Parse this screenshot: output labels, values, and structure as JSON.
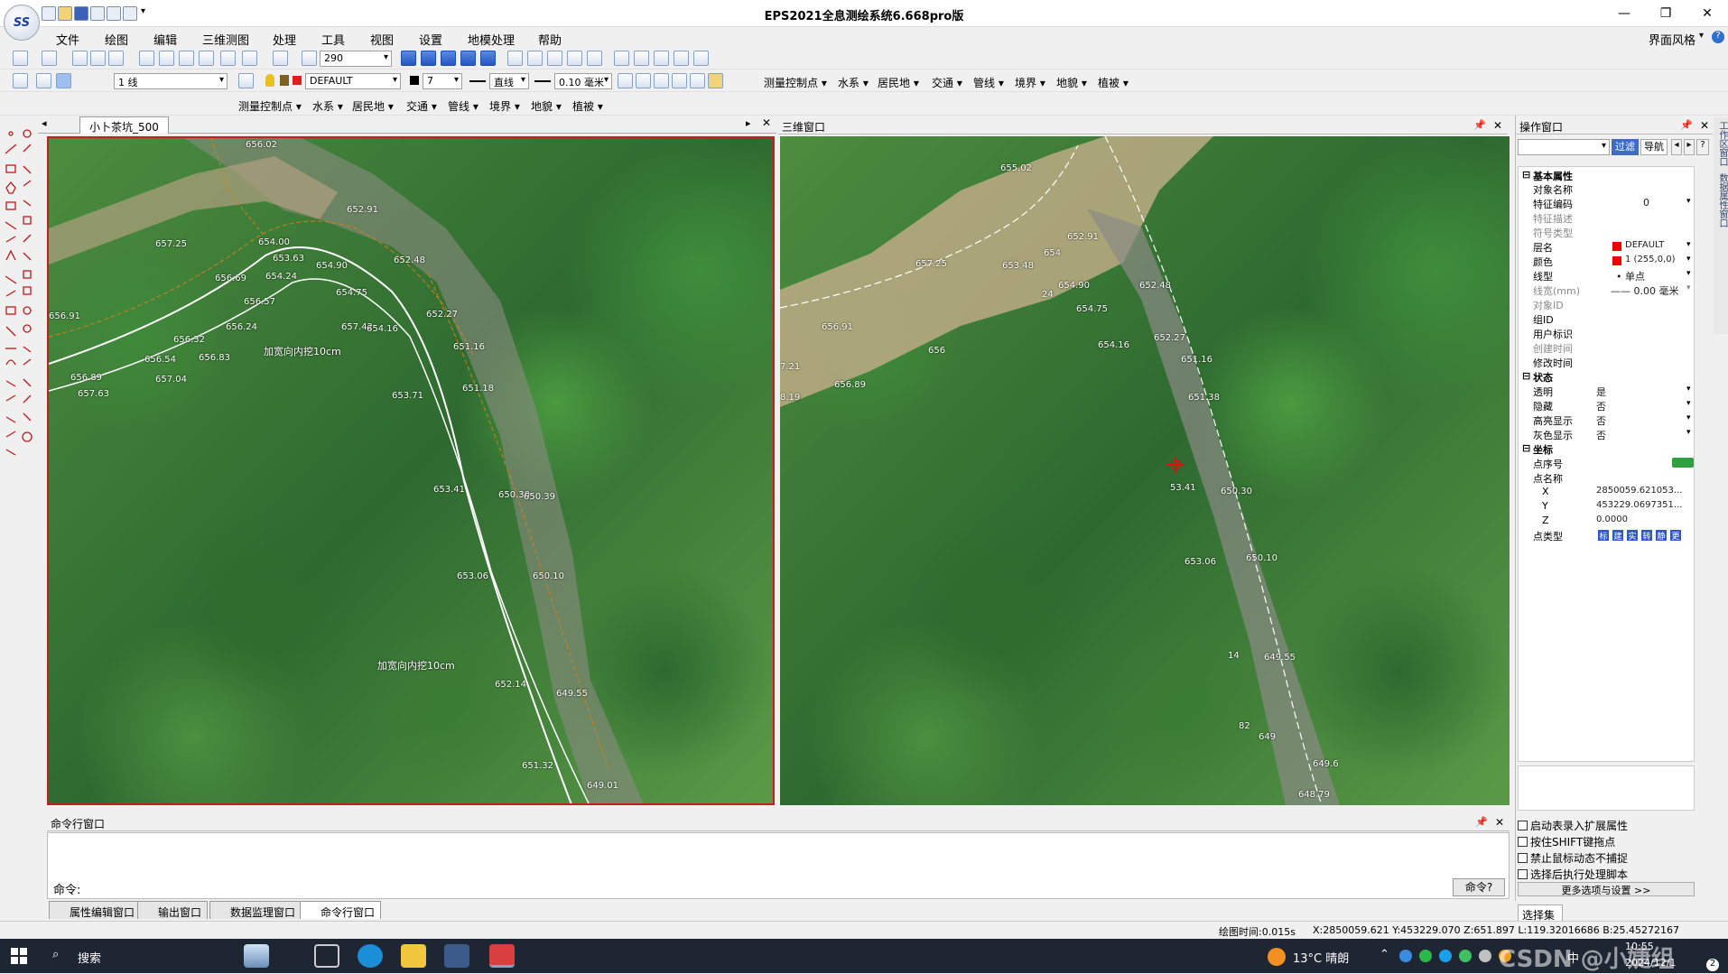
{
  "app": {
    "title": "EPS2021全息测绘系统6.668pro版",
    "logo": "SS",
    "window_buttons": [
      "—",
      "❐",
      "✕"
    ]
  },
  "menu": [
    "文件",
    "绘图",
    "编辑",
    "三维测图",
    "处理",
    "工具",
    "视图",
    "设置",
    "地模处理",
    "帮助"
  ],
  "menu_right": {
    "style_label": "界面风格",
    "help_icon": "?"
  },
  "toolbar1": {
    "zoom_value": "290"
  },
  "toolbar2": {
    "line_mode": "1 线",
    "layer": "DEFAULT",
    "color_value": "7",
    "linetype": "直线",
    "linewidth": "0.10 毫米"
  },
  "category_dropdowns": [
    "测量控制点",
    "水系",
    "居民地",
    "交通",
    "管线",
    "境界",
    "地貌",
    "植被"
  ],
  "left_panel": {
    "tab_title": "小卜茶坑_500",
    "labels": [
      "656.02",
      "652.91",
      "657.25",
      "654.00",
      "653.63",
      "652.48",
      "654.90",
      "656.69",
      "654.24",
      "654.75",
      "656.91",
      "656.57",
      "656.24",
      "657.42",
      "654.16",
      "652.27",
      "656.32",
      "656.54",
      "656.83",
      "651.16",
      "656.89",
      "657.04",
      "651.18",
      "657.63",
      "653.71",
      "653.41",
      "650.30",
      "650.39",
      "653.06",
      "650.10",
      "652.14",
      "649.55",
      "651.32",
      "649.01"
    ],
    "annotations": [
      "加宽向内挖10cm",
      "加宽向内挖10cm"
    ]
  },
  "right_panel": {
    "title": "三维窗口",
    "labels": [
      "655.02",
      "652.91",
      "657.25",
      "653.48",
      "654",
      "24",
      "654.90",
      "652.48",
      "656.91",
      "654.75",
      "656",
      "654.16",
      "652.27",
      "7.21",
      "651.16",
      "656.89",
      "651.38",
      "8.19",
      "53.41",
      "650.30",
      "653.06",
      "650.10",
      "14",
      "649.55",
      "82",
      "649",
      "649.6",
      "648.79"
    ]
  },
  "operation": {
    "title": "操作窗口",
    "filter_btn": "过滤",
    "nav_btn": "导航",
    "nav_arrows": [
      "◂",
      "▸"
    ],
    "help": "?",
    "sections": {
      "basic": {
        "title": "基本属性",
        "rows": [
          {
            "k": "对象名称",
            "v": ""
          },
          {
            "k": "特征编码",
            "v": "0"
          },
          {
            "k": "特征描述",
            "v": ""
          },
          {
            "k": "符号类型",
            "v": ""
          },
          {
            "k": "层名",
            "v": "DEFAULT"
          },
          {
            "k": "颜色",
            "v": "1 (255,0,0)"
          },
          {
            "k": "线型",
            "v": "• 单点"
          },
          {
            "k": "线宽(mm)",
            "v": "—— 0.00 毫米"
          },
          {
            "k": "对象ID",
            "v": ""
          },
          {
            "k": "组ID",
            "v": ""
          },
          {
            "k": "用户标识",
            "v": ""
          },
          {
            "k": "创建时间",
            "v": ""
          },
          {
            "k": "修改时间",
            "v": ""
          }
        ]
      },
      "state": {
        "title": "状态",
        "rows": [
          {
            "k": "透明",
            "v": "是"
          },
          {
            "k": "隐藏",
            "v": "否"
          },
          {
            "k": "高亮显示",
            "v": "否"
          },
          {
            "k": "灰色显示",
            "v": "否"
          }
        ]
      },
      "coord": {
        "title": "坐标",
        "rows": [
          {
            "k": "点序号",
            "v": ""
          },
          {
            "k": "点名称",
            "v": ""
          },
          {
            "k": "X",
            "v": "2850059.621053..."
          },
          {
            "k": "Y",
            "v": "453229.0697351..."
          },
          {
            "k": "Z",
            "v": "0.0000"
          },
          {
            "k": "点类型",
            "v": ""
          }
        ],
        "pt_types": [
          "标",
          "建",
          "实",
          "转",
          "静",
          "更"
        ]
      }
    },
    "checks": [
      "启动表录入扩展属性",
      "按住SHIFT键拖点",
      "禁止鼠标动态不捕捉",
      "选择后执行处理脚本"
    ],
    "more_btn": "更多选项与设置 >>",
    "select_set": "选择集"
  },
  "vertical_tabs": [
    "工作区窗口",
    "数据属性窗口"
  ],
  "command": {
    "title": "命令行窗口",
    "prompt": "命令:",
    "btn": "命令?"
  },
  "bottom_tabs": [
    "属性编辑窗口",
    "输出窗口",
    "数据监理窗口",
    "命令行窗口"
  ],
  "status": {
    "draw_time": "绘图时间:0.015s",
    "coords": "X:2850059.621 Y:453229.070 Z:651.897 L:119.32016686 B:25.45272167"
  },
  "taskbar": {
    "search": "搜索",
    "weather": "13°C 晴朗",
    "ime": "中",
    "time": "10:55",
    "date": "2024/12/1",
    "watermark": "CSDN @小婕组",
    "badge": "2"
  }
}
